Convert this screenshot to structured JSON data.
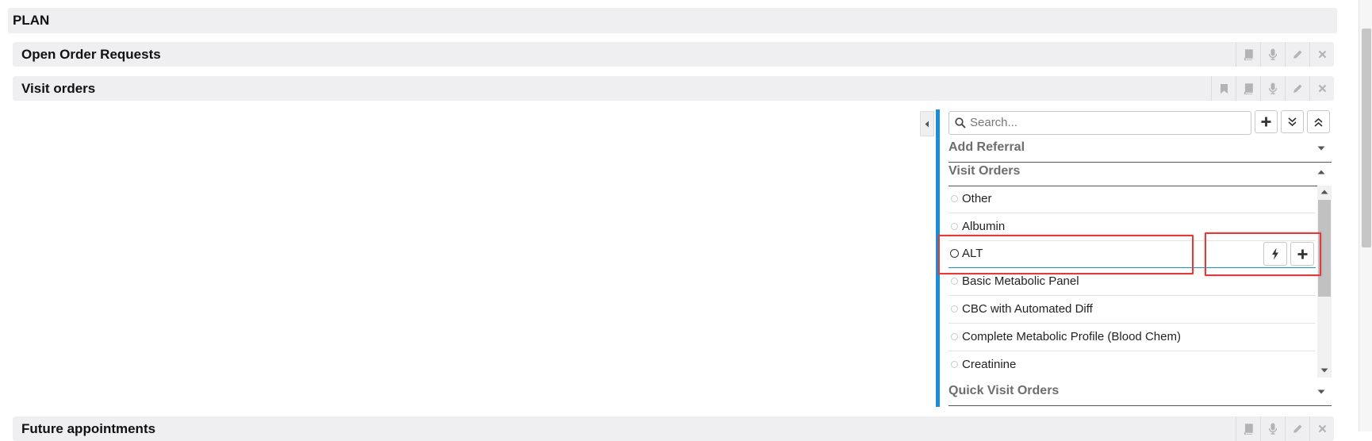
{
  "plan": {
    "title": "PLAN"
  },
  "sections": {
    "open_order_requests": {
      "title": "Open Order Requests"
    },
    "visit_orders": {
      "title": "Visit orders"
    },
    "future_appointments": {
      "title": "Future appointments"
    }
  },
  "bar_icons": [
    "bookmark-icon",
    "book-icon",
    "microphone-icon",
    "pencil-icon",
    "close-icon"
  ],
  "panel": {
    "search_placeholder": "Search...",
    "toolbar_icons": [
      "plus-icon",
      "double-chevron-down-icon",
      "double-chevron-up-icon"
    ],
    "categories": [
      {
        "label": "Add Referral",
        "state": "collapsed"
      },
      {
        "label": "Visit Orders",
        "state": "expanded"
      },
      {
        "label": "Quick Visit Orders",
        "state": "collapsed"
      }
    ],
    "visit_orders": [
      {
        "label": "Other"
      },
      {
        "label": "Albumin"
      },
      {
        "label": "ALT",
        "active": true
      },
      {
        "label": "Basic Metabolic Panel"
      },
      {
        "label": "CBC with Automated Diff"
      },
      {
        "label": "Complete Metabolic Profile (Blood Chem)"
      },
      {
        "label": "Creatinine"
      }
    ],
    "row_actions": [
      "lightning-icon",
      "plus-icon"
    ]
  },
  "colors": {
    "accent": "#1b8ed8",
    "highlight": "#e03c3c",
    "bar_background": "#efeff1",
    "category_text": "#6d6d6d"
  }
}
